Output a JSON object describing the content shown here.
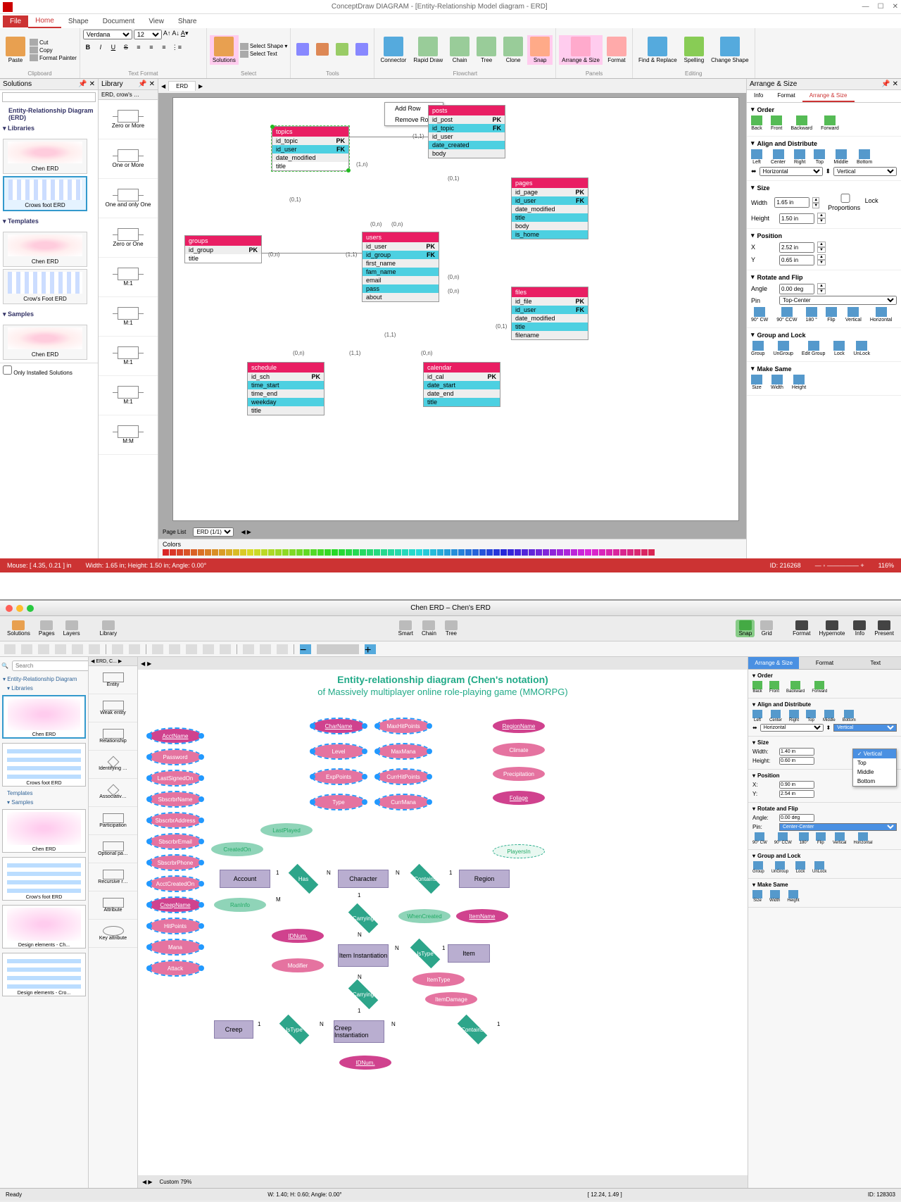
{
  "win": {
    "title": "ConceptDraw DIAGRAM - [Entity-Relationship Model diagram - ERD]",
    "menus": {
      "file": "File",
      "home": "Home",
      "shape": "Shape",
      "document": "Document",
      "view": "View",
      "share": "Share"
    },
    "ribbon": {
      "paste": "Paste",
      "cut": "Cut",
      "copy": "Copy",
      "fmtpaint": "Format Painter",
      "clipboard": "Clipboard",
      "font": "Verdana",
      "size": "12",
      "textformat": "Text Format",
      "solutions": "Solutions",
      "selectshape": "Select Shape",
      "selecttext": "Select Text",
      "select": "Select",
      "tools": "Tools",
      "connector": "Connector",
      "rapiddraw": "Rapid Draw",
      "chain": "Chain",
      "tree": "Tree",
      "clone": "Clone",
      "snap": "Snap",
      "arrangesize": "Arrange & Size",
      "format": "Format",
      "panels": "Panels",
      "findreplace": "Find & Replace",
      "spelling": "Spelling",
      "changeshape": "Change Shape",
      "editing": "Editing",
      "flowchart": "Flowchart"
    },
    "solutions": {
      "title": "Solutions",
      "tree_root": "Entity-Relationship Diagram (ERD)",
      "libraries": "Libraries",
      "templates": "Templates",
      "samples": "Samples",
      "chen": "Chen ERD",
      "crow": "Crows foot ERD",
      "crow2": "Crow's Foot ERD",
      "only_installed": "Only Installed Solutions"
    },
    "library": {
      "title": "Library",
      "tab": "ERD, crow's …",
      "items": [
        "Zero or More",
        "One or More",
        "One and only One",
        "Zero or One",
        "M:1",
        "M:1",
        "M:1",
        "M:1",
        "M:M"
      ]
    },
    "canvas": {
      "tabs": {
        "left": "ERD",
        "page": "ERD (1/1)",
        "pagelist": "Page List"
      },
      "context": {
        "addrow": "Add Row",
        "removerow": "Remove Row"
      },
      "tables": {
        "topics": {
          "title": "topics",
          "cols": [
            [
              "id_topic",
              "PK"
            ],
            [
              "id_user",
              "FK"
            ],
            [
              "date_modified",
              ""
            ],
            [
              "title",
              ""
            ]
          ]
        },
        "posts": {
          "title": "posts",
          "cols": [
            [
              "id_post",
              "PK"
            ],
            [
              "id_topic",
              "FK"
            ],
            [
              "id_user",
              ""
            ],
            [
              "date_created",
              ""
            ],
            [
              "body",
              ""
            ]
          ]
        },
        "pages": {
          "title": "pages",
          "cols": [
            [
              "id_page",
              "PK"
            ],
            [
              "id_user",
              "FK"
            ],
            [
              "date_modified",
              ""
            ],
            [
              "title",
              ""
            ],
            [
              "body",
              ""
            ],
            [
              "is_home",
              ""
            ]
          ]
        },
        "groups": {
          "title": "groups",
          "cols": [
            [
              "id_group",
              "PK"
            ],
            [
              "title",
              ""
            ]
          ]
        },
        "users": {
          "title": "users",
          "cols": [
            [
              "id_user",
              "PK"
            ],
            [
              "id_group",
              "FK"
            ],
            [
              "first_name",
              ""
            ],
            [
              "fam_name",
              ""
            ],
            [
              "email",
              ""
            ],
            [
              "pass",
              ""
            ],
            [
              "about",
              ""
            ]
          ]
        },
        "files": {
          "title": "files",
          "cols": [
            [
              "id_file",
              "PK"
            ],
            [
              "id_user",
              "FK"
            ],
            [
              "date_modified",
              ""
            ],
            [
              "title",
              ""
            ],
            [
              "filename",
              ""
            ]
          ]
        },
        "schedule": {
          "title": "schedule",
          "cols": [
            [
              "id_sch",
              "PK"
            ],
            [
              "time_start",
              ""
            ],
            [
              "time_end",
              ""
            ],
            [
              "weekday",
              ""
            ],
            [
              "title",
              ""
            ]
          ]
        },
        "calendar": {
          "title": "calendar",
          "cols": [
            [
              "id_cal",
              "PK"
            ],
            [
              "date_start",
              ""
            ],
            [
              "date_end",
              ""
            ],
            [
              "title",
              ""
            ]
          ]
        }
      },
      "labels": {
        "l1": "(1,1)",
        "l2": "(1,n)",
        "l3": "(0,1)",
        "l4": "(0,n)",
        "l5": "(1,1)"
      },
      "colors_label": "Colors"
    },
    "right": {
      "title": "Arrange & Size",
      "tabs": {
        "info": "Info",
        "format": "Format",
        "arrange": "Arrange & Size"
      },
      "order": {
        "hdr": "Order",
        "back": "Back",
        "front": "Front",
        "backward": "Backward",
        "forward": "Forward"
      },
      "align": {
        "hdr": "Align and Distribute",
        "left": "Left",
        "center": "Center",
        "right": "Right",
        "top": "Top",
        "middle": "Middle",
        "bottom": "Bottom",
        "horiz": "Horizontal",
        "vert": "Vertical"
      },
      "size": {
        "hdr": "Size",
        "width_l": "Width",
        "width": "1.65 in",
        "height_l": "Height",
        "height": "1.50 in",
        "lock": "Lock Proportions"
      },
      "pos": {
        "hdr": "Position",
        "x_l": "X",
        "x": "2.52 in",
        "y_l": "Y",
        "y": "0.65 in"
      },
      "rotate": {
        "hdr": "Rotate and Flip",
        "angle_l": "Angle",
        "angle": "0.00 deg",
        "pin_l": "Pin",
        "pin": "Top-Center",
        "cw": "90° CW",
        "ccw": "90° CCW",
        "r180": "180 °",
        "flip": "Flip",
        "vert": "Vertical",
        "horiz": "Horizontal"
      },
      "group": {
        "hdr": "Group and Lock",
        "group": "Group",
        "ungroup": "UnGroup",
        "editgroup": "Edit Group",
        "lock": "Lock",
        "unlock": "UnLock"
      },
      "same": {
        "hdr": "Make Same",
        "size": "Size",
        "width": "Width",
        "height": "Height"
      }
    },
    "status": {
      "mouse": "Mouse: [ 4.35, 0.21 ] in",
      "dims": "Width: 1.65 in; Height: 1.50 in; Angle: 0.00°",
      "id": "ID: 216268",
      "zoom": "116%"
    }
  },
  "mac": {
    "title": "Chen ERD – Chen's ERD",
    "toolbar": {
      "solutions": "Solutions",
      "pages": "Pages",
      "layers": "Layers",
      "library": "Library",
      "smart": "Smart",
      "chain": "Chain",
      "tree": "Tree",
      "snap": "Snap",
      "grid": "Grid",
      "format": "Format",
      "hypernote": "Hypernote",
      "info": "Info",
      "present": "Present"
    },
    "left": {
      "search_ph": "Search",
      "tree_root": "Entity-Relationship Diagram",
      "libraries": "Libraries",
      "templates": "Templates",
      "samples": "Samples",
      "chen": "Chen ERD",
      "crow": "Crows foot ERD",
      "crow2": "Crow's foot ERD",
      "de_chen": "Design elements - Ch...",
      "de_crow": "Design elements - Cro..."
    },
    "lib": {
      "tab": "ERD, C...",
      "items": [
        "Entity",
        "Weak entity",
        "Relationship",
        "Identifying …",
        "Associativ…",
        "Participation",
        "Optional pa…",
        "Recursive r…",
        "Attribute",
        "Key attribute"
      ]
    },
    "canvas": {
      "title": "Entity-relationship diagram (Chen's notation)",
      "subtitle": "of Massively multiplayer online role-playing game (MMORPG)",
      "entities": {
        "account": "Account",
        "character": "Character",
        "region": "Region",
        "item": "Item",
        "iteminst": "Item Instantiation",
        "creep": "Creep",
        "creepinst": "Creep Instantiation"
      },
      "rels": {
        "has": "Has",
        "contains": "Contains",
        "carrying": "Carrying",
        "contains2": "Contains",
        "istype": "IsType",
        "carrying2": "Carrying",
        "istype2": "IsType"
      },
      "attrs": {
        "acctname": "AcctName",
        "password": "Password",
        "lastsigned": "LastSignedOn",
        "sbscrbrname": "SbscrbrName",
        "sbscrbraddr": "SbscrbrAddress",
        "sbscrbremail": "SbscrbrEmail",
        "sbscrbrphone": "SbscrbrPhone",
        "acctcreated": "AcctCreatedOn",
        "creepname": "CreepName",
        "hitpoints": "HitPoints",
        "mana": "Mana",
        "attack": "Attack",
        "charname": "CharName",
        "level": "Level",
        "exppoints": "ExpPoints",
        "type": "Type",
        "maxhp": "MaxHitPoints",
        "maxmana": "MaxMana",
        "currhp": "CurrHitPoints",
        "currmana": "CurrMana",
        "regionname": "RegionName",
        "climate": "Climate",
        "precip": "Precipitation",
        "foliage": "Foliage",
        "playersin": "PlayersIn",
        "itemname": "ItemName",
        "itemtype": "ItemType",
        "itemdamage": "ItemDamage",
        "createdon": "CreatedOn",
        "lastplayed": "LastPlayed",
        "raninfo": "RanInfo",
        "idnum": "IDNum.",
        "modifier": "Modifier",
        "whencreated": "WhenCreated",
        "idnum2": "IDNum."
      },
      "card": {
        "one": "1",
        "n": "N",
        "m": "M"
      },
      "footer": "Custom 79%"
    },
    "right": {
      "tabs": {
        "arrange": "Arrange & Size",
        "format": "Format",
        "text": "Text"
      },
      "order": {
        "hdr": "Order",
        "back": "Back",
        "front": "Front",
        "backward": "Backward",
        "forward": "Forward"
      },
      "align": {
        "hdr": "Align and Distribute",
        "left": "Left",
        "center": "Center",
        "right": "Right",
        "top": "Top",
        "middle": "Middle",
        "bottom": "Bottom",
        "horiz": "Horizontal",
        "vert": "Vertical"
      },
      "size": {
        "hdr": "Size",
        "width_l": "Width:",
        "width": "1.40 in",
        "height_l": "Height:",
        "height": "0.60 in"
      },
      "pos": {
        "hdr": "Position",
        "x_l": "X:",
        "x": "0.90 in",
        "y_l": "Y:",
        "y": "2.54 in"
      },
      "rotate": {
        "hdr": "Rotate and Flip",
        "angle_l": "Angle:",
        "angle": "0.00 deg",
        "pin_l": "Pin:",
        "pin": "Center-Center",
        "cw": "90° CW",
        "ccw": "90° CCW",
        "r180": "180°",
        "flip": "Flip",
        "vert": "Vertical",
        "horiz": "Horizontal"
      },
      "group": {
        "hdr": "Group and Lock",
        "group": "Group",
        "ungroup": "UnGroup",
        "lock": "Lock",
        "unlock": "UnLock"
      },
      "same": {
        "hdr": "Make Same",
        "size": "Size",
        "width": "Width",
        "height": "Height"
      },
      "dropdown": {
        "vertical": "Vertical",
        "top": "Top",
        "middle": "Middle",
        "bottom": "Bottom"
      }
    },
    "status": {
      "ready": "Ready",
      "dims": "W: 1.40; H: 0.60; Angle: 0.00°",
      "pos": "[ 12.24, 1.49 ]",
      "id": "ID: 128303"
    }
  }
}
